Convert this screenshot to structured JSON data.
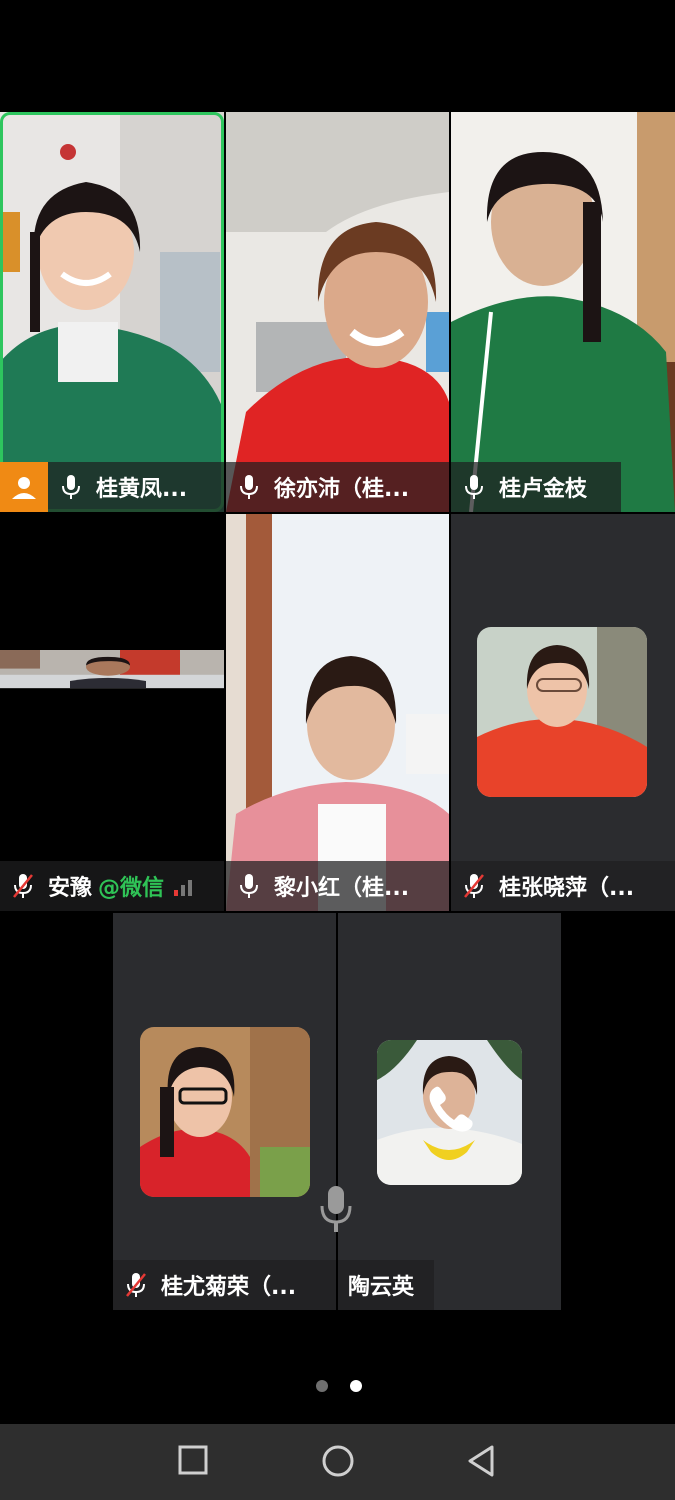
{
  "participants": [
    {
      "name": "桂黄凤...",
      "mic": "on",
      "host": true,
      "speaking": true
    },
    {
      "name": "徐亦沛（桂...",
      "mic": "on"
    },
    {
      "name": "桂卢金枝",
      "mic": "on"
    },
    {
      "name": "安豫",
      "tag": "@微信",
      "mic": "muted",
      "signal": true
    },
    {
      "name": "黎小红（桂...",
      "mic": "on"
    },
    {
      "name": "桂张晓萍（...",
      "mic": "muted",
      "camera": "off"
    },
    {
      "name": "桂尤菊荣（...",
      "mic": "muted",
      "camera": "off"
    },
    {
      "name": "陶云英",
      "mic": "none",
      "phone": true,
      "camera": "off"
    }
  ],
  "colors": {
    "speaking_border": "#2ec55e",
    "host_badge": "#f08a14",
    "wechat_tag": "#2fc356",
    "tile_bg": "#2b2c2f"
  },
  "icons": [
    "mic-icon",
    "mic-muted-icon",
    "host-icon",
    "phone-icon",
    "signal-icon",
    "square-nav-icon",
    "circle-nav-icon",
    "back-triangle-icon"
  ],
  "pager": {
    "pages": 2,
    "current": 2
  }
}
